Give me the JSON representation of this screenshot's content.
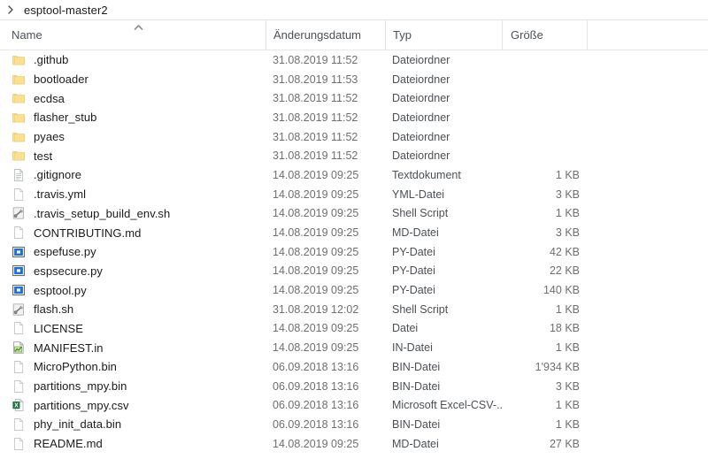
{
  "breadcrumb": {
    "chevron_icon": "chevron-right-icon",
    "path_label": "esptool-master2"
  },
  "columns": {
    "name": "Name",
    "date_modified": "Änderungsdatum",
    "type": "Typ",
    "size": "Größe",
    "sort_icon": "sort-ascending-icon",
    "sorted_by": "Name"
  },
  "files": [
    {
      "name": ".github",
      "icon": "folder-icon",
      "date": "31.08.2019 11:52",
      "type": "Dateiordner",
      "size": ""
    },
    {
      "name": "bootloader",
      "icon": "folder-icon",
      "date": "31.08.2019 11:53",
      "type": "Dateiordner",
      "size": ""
    },
    {
      "name": "ecdsa",
      "icon": "folder-icon",
      "date": "31.08.2019 11:52",
      "type": "Dateiordner",
      "size": ""
    },
    {
      "name": "flasher_stub",
      "icon": "folder-icon",
      "date": "31.08.2019 11:52",
      "type": "Dateiordner",
      "size": ""
    },
    {
      "name": "pyaes",
      "icon": "folder-icon",
      "date": "31.08.2019 11:52",
      "type": "Dateiordner",
      "size": ""
    },
    {
      "name": "test",
      "icon": "folder-icon",
      "date": "31.08.2019 11:52",
      "type": "Dateiordner",
      "size": ""
    },
    {
      "name": ".gitignore",
      "icon": "text-document-icon",
      "date": "14.08.2019 09:25",
      "type": "Textdokument",
      "size": "1 KB"
    },
    {
      "name": ".travis.yml",
      "icon": "blank-document-icon",
      "date": "14.08.2019 09:25",
      "type": "YML-Datei",
      "size": "3 KB"
    },
    {
      "name": ".travis_setup_build_env.sh",
      "icon": "shell-script-icon",
      "date": "14.08.2019 09:25",
      "type": "Shell Script",
      "size": "1 KB"
    },
    {
      "name": "CONTRIBUTING.md",
      "icon": "blank-document-icon",
      "date": "14.08.2019 09:25",
      "type": "MD-Datei",
      "size": "3 KB"
    },
    {
      "name": "espefuse.py",
      "icon": "python-file-icon",
      "date": "14.08.2019 09:25",
      "type": "PY-Datei",
      "size": "42 KB"
    },
    {
      "name": "espsecure.py",
      "icon": "python-file-icon",
      "date": "14.08.2019 09:25",
      "type": "PY-Datei",
      "size": "22 KB"
    },
    {
      "name": "esptool.py",
      "icon": "python-file-icon",
      "date": "14.08.2019 09:25",
      "type": "PY-Datei",
      "size": "140 KB"
    },
    {
      "name": "flash.sh",
      "icon": "shell-script-icon",
      "date": "31.08.2019 12:02",
      "type": "Shell Script",
      "size": "1 KB"
    },
    {
      "name": "LICENSE",
      "icon": "blank-document-icon",
      "date": "14.08.2019 09:25",
      "type": "Datei",
      "size": "18 KB"
    },
    {
      "name": "MANIFEST.in",
      "icon": "chart-file-icon",
      "date": "14.08.2019 09:25",
      "type": "IN-Datei",
      "size": "1 KB"
    },
    {
      "name": "MicroPython.bin",
      "icon": "blank-document-icon",
      "date": "06.09.2018 13:16",
      "type": "BIN-Datei",
      "size": "1'934 KB"
    },
    {
      "name": "partitions_mpy.bin",
      "icon": "blank-document-icon",
      "date": "06.09.2018 13:16",
      "type": "BIN-Datei",
      "size": "3 KB"
    },
    {
      "name": "partitions_mpy.csv",
      "icon": "excel-csv-icon",
      "date": "06.09.2018 13:16",
      "type": "Microsoft Excel-CSV-...",
      "size": "1 KB"
    },
    {
      "name": "phy_init_data.bin",
      "icon": "blank-document-icon",
      "date": "06.09.2018 13:16",
      "type": "BIN-Datei",
      "size": "1 KB"
    },
    {
      "name": "README.md",
      "icon": "blank-document-icon",
      "date": "14.08.2019 09:25",
      "type": "MD-Datei",
      "size": "27 KB"
    }
  ],
  "colors": {
    "folder": "#FCE49A",
    "folder_edge": "#E9CE7A",
    "python_blue": "#1E6FD9",
    "excel_green": "#1F7244",
    "text": "#1b1b1b",
    "muted_text": "#6f6f6f",
    "divider": "#e7e7e7"
  }
}
